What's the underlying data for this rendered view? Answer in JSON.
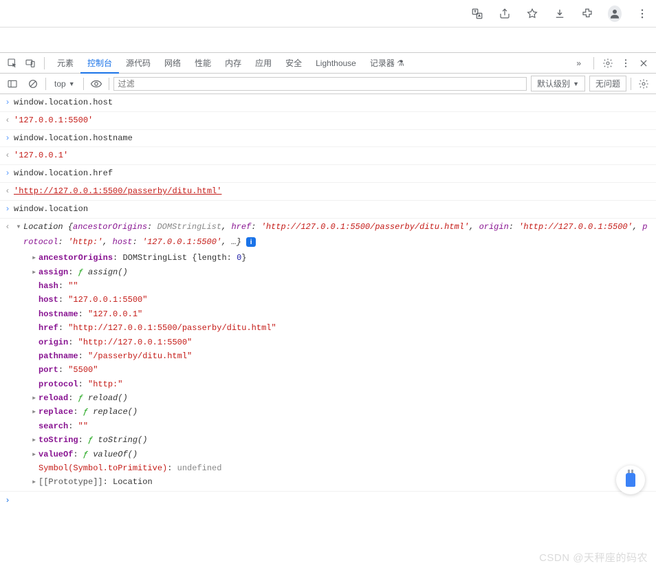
{
  "browser_icons": [
    "translate-icon",
    "share-icon",
    "star-icon",
    "download-icon",
    "extensions-icon",
    "profile-icon",
    "menu-icon"
  ],
  "tabs": {
    "items": [
      "元素",
      "控制台",
      "源代码",
      "网络",
      "性能",
      "内存",
      "应用",
      "安全",
      "Lighthouse",
      "记录器"
    ],
    "active_index": 1,
    "recorder_suffix": "⚗",
    "more": "»"
  },
  "toolbar": {
    "context": "top",
    "filter_placeholder": "过滤",
    "level_label": "默认级别",
    "issues_label": "无问题"
  },
  "console_entries": [
    {
      "type": "in",
      "text": "window.location.host"
    },
    {
      "type": "out",
      "kind": "str",
      "text": "'127.0.0.1:5500'"
    },
    {
      "type": "in",
      "text": "window.location.hostname"
    },
    {
      "type": "out",
      "kind": "str",
      "text": "'127.0.0.1'"
    },
    {
      "type": "in",
      "text": "window.location.href"
    },
    {
      "type": "out",
      "kind": "link",
      "text": "'http://127.0.0.1:5500/passerby/ditu.html'"
    },
    {
      "type": "in",
      "text": "window.location"
    }
  ],
  "location_summary": {
    "prefix": "Location {",
    "parts": [
      {
        "k": "ancestorOrigins",
        "grey": "DOMStringList"
      },
      {
        "k": "href",
        "v": "'http://127.0.0.1:5500/passerby/ditu.html'"
      },
      {
        "k": "origin",
        "v": "'http://127.0.0.1:5500'"
      },
      {
        "k": "protocol",
        "v": "'http:'"
      },
      {
        "k": "host",
        "v": "'127.0.0.1:5500'"
      }
    ],
    "suffix": ", …}"
  },
  "location_props": [
    {
      "caret": true,
      "key": "ancestorOrigins",
      "type": "obj",
      "value": "DOMStringList {length: ",
      "num": "0",
      "tail": "}"
    },
    {
      "caret": true,
      "key": "assign",
      "type": "fn",
      "value": "assign()"
    },
    {
      "caret": false,
      "key": "hash",
      "type": "str",
      "value": "\"\""
    },
    {
      "caret": false,
      "key": "host",
      "type": "str",
      "value": "\"127.0.0.1:5500\""
    },
    {
      "caret": false,
      "key": "hostname",
      "type": "str",
      "value": "\"127.0.0.1\""
    },
    {
      "caret": false,
      "key": "href",
      "type": "str",
      "value": "\"http://127.0.0.1:5500/passerby/ditu.html\""
    },
    {
      "caret": false,
      "key": "origin",
      "type": "str",
      "value": "\"http://127.0.0.1:5500\""
    },
    {
      "caret": false,
      "key": "pathname",
      "type": "str",
      "value": "\"/passerby/ditu.html\""
    },
    {
      "caret": false,
      "key": "port",
      "type": "str",
      "value": "\"5500\""
    },
    {
      "caret": false,
      "key": "protocol",
      "type": "str",
      "value": "\"http:\""
    },
    {
      "caret": true,
      "key": "reload",
      "type": "fn",
      "value": "reload()"
    },
    {
      "caret": true,
      "key": "replace",
      "type": "fn",
      "value": "replace()"
    },
    {
      "caret": false,
      "key": "search",
      "type": "str",
      "value": "\"\""
    },
    {
      "caret": true,
      "key": "toString",
      "type": "fn",
      "value": "toString()"
    },
    {
      "caret": true,
      "key": "valueOf",
      "type": "fn",
      "value": "valueOf()"
    },
    {
      "caret": false,
      "key": "Symbol(Symbol.toPrimitive)",
      "type": "undef",
      "value": "undefined",
      "sym": true
    },
    {
      "caret": true,
      "key": "[[Prototype]]",
      "type": "plain",
      "value": "Location",
      "proto": true
    }
  ],
  "watermark": "CSDN @天秤座的码农"
}
